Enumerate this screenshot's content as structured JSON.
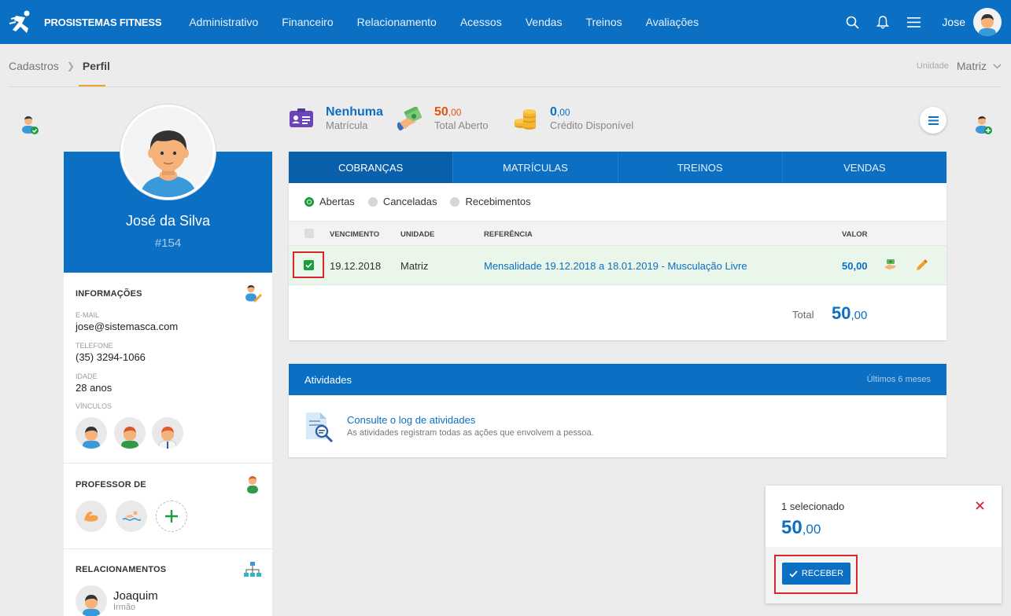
{
  "header": {
    "brand": "PROSISTEMAS FITNESS",
    "menu": [
      "Administrativo",
      "Financeiro",
      "Relacionamento",
      "Acessos",
      "Vendas",
      "Treinos",
      "Avaliações"
    ],
    "user_name": "Jose"
  },
  "breadcrumb": {
    "root": "Cadastros",
    "current": "Perfil"
  },
  "unit": {
    "label": "Unidade",
    "value": "Matriz"
  },
  "profile": {
    "name": "José da Silva",
    "id": "#154",
    "info_title": "INFORMAÇÕES",
    "email_label": "E-MAIL",
    "email": "jose@sistemasca.com",
    "phone_label": "TELEFONE",
    "phone": "(35) 3294-1066",
    "age_label": "IDADE",
    "age": "28 anos",
    "links_label": "VÍNCULOS",
    "teacher_title": "PROFESSOR DE",
    "relations_title": "RELACIONAMENTOS",
    "relation_name": "Joaquim",
    "relation_type": "Irmão"
  },
  "summary": {
    "enrollment_value": "Nenhuma",
    "enrollment_label": "Matrícula",
    "open_int": "50",
    "open_dec": ",00",
    "open_label": "Total Aberto",
    "credit_int": "0",
    "credit_dec": ",00",
    "credit_label": "Crédito Disponível"
  },
  "tabs": [
    "COBRANÇAS",
    "MATRÍCULAS",
    "TREINOS",
    "VENDAS"
  ],
  "filters": [
    "Abertas",
    "Canceladas",
    "Recebimentos"
  ],
  "table": {
    "headers": {
      "due": "VENCIMENTO",
      "unit": "UNIDADE",
      "ref": "REFERÊNCIA",
      "value": "VALOR"
    },
    "row": {
      "due": "19.12.2018",
      "unit": "Matriz",
      "ref": "Mensalidade 19.12.2018 a 18.01.2019 - Musculação Livre",
      "value": "50,00"
    },
    "total_label": "Total",
    "total_int": "50",
    "total_dec": ",00"
  },
  "activities": {
    "title": "Atividades",
    "range": "Últimos 6 meses",
    "link": "Consulte o log de atividades",
    "desc": "As atividades registram todas as ações que envolvem a pessoa."
  },
  "selection": {
    "count": "1 selecionado",
    "value_int": "50",
    "value_dec": ",00",
    "receive_label": "RECEBER"
  },
  "colors": {
    "primary": "#0b6fc3",
    "accent_orange": "#e0560f",
    "success": "#1a9d3e",
    "highlight_red": "#d7262c"
  }
}
